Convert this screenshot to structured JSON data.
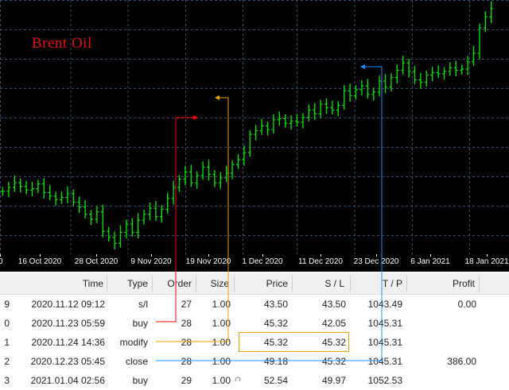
{
  "chart": {
    "symbol": "Brent Oil",
    "background": "#000000",
    "grid_color": "#2f4f6f",
    "candle_color": "#00dd00",
    "x_ticks": [
      "0",
      "16 Oct 2020",
      "28 Oct 2020",
      "9 Nov 2020",
      "19 Nov 2020",
      "1 Dec 2020",
      "11 Dec 2020",
      "23 Dec 2020",
      "6 Jan 2021",
      "18 Jan 2021"
    ]
  },
  "chart_data": {
    "type": "candlestick",
    "title": "Brent Oil",
    "x_start": "2020-10-05",
    "y_range": [
      35,
      56
    ],
    "candles": [
      [
        0,
        40.2
      ],
      [
        1,
        40.5
      ],
      [
        2,
        40.9
      ],
      [
        3,
        40.6
      ],
      [
        4,
        40.3
      ],
      [
        5,
        40.4
      ],
      [
        6,
        40.8
      ],
      [
        7,
        40.1
      ],
      [
        8,
        39.8
      ],
      [
        9,
        39.5
      ],
      [
        10,
        39.7
      ],
      [
        11,
        40.0
      ],
      [
        12,
        39.3
      ],
      [
        13,
        38.9
      ],
      [
        14,
        38.3
      ],
      [
        15,
        37.9
      ],
      [
        16,
        38.5
      ],
      [
        17,
        36.9
      ],
      [
        18,
        36.4
      ],
      [
        19,
        35.9
      ],
      [
        20,
        36.8
      ],
      [
        21,
        37.5
      ],
      [
        22,
        36.8
      ],
      [
        23,
        37.8
      ],
      [
        24,
        38.3
      ],
      [
        25,
        38.8
      ],
      [
        26,
        38.1
      ],
      [
        27,
        38.7
      ],
      [
        28,
        39.6
      ],
      [
        29,
        40.5
      ],
      [
        30,
        41.2
      ],
      [
        31,
        41.8
      ],
      [
        32,
        40.9
      ],
      [
        33,
        41.5
      ],
      [
        34,
        42.2
      ],
      [
        35,
        41.6
      ],
      [
        36,
        40.9
      ],
      [
        37,
        41.3
      ],
      [
        38,
        41.7
      ],
      [
        39,
        42.4
      ],
      [
        40,
        42.8
      ],
      [
        41,
        43.4
      ],
      [
        42,
        44.9
      ],
      [
        43,
        45.2
      ],
      [
        44,
        45.6
      ],
      [
        45,
        45.3
      ],
      [
        46,
        46.1
      ],
      [
        47,
        46.2
      ],
      [
        48,
        45.8
      ],
      [
        49,
        46.0
      ],
      [
        50,
        45.9
      ],
      [
        51,
        46.3
      ],
      [
        52,
        46.9
      ],
      [
        53,
        46.6
      ],
      [
        54,
        47.4
      ],
      [
        55,
        47.1
      ],
      [
        56,
        46.9
      ],
      [
        57,
        47.3
      ],
      [
        58,
        48.5
      ],
      [
        59,
        48.1
      ],
      [
        60,
        48.6
      ],
      [
        61,
        48.9
      ],
      [
        62,
        48.2
      ],
      [
        63,
        48.4
      ],
      [
        64,
        49.3
      ],
      [
        65,
        48.8
      ],
      [
        66,
        49.6
      ],
      [
        67,
        50.2
      ],
      [
        68,
        50.8
      ],
      [
        69,
        50.1
      ],
      [
        70,
        49.4
      ],
      [
        71,
        49.2
      ],
      [
        72,
        49.8
      ],
      [
        73,
        50.0
      ],
      [
        74,
        49.9
      ],
      [
        75,
        50.1
      ],
      [
        76,
        50.4
      ],
      [
        77,
        50.2
      ],
      [
        78,
        50.3
      ],
      [
        79,
        50.9
      ],
      [
        80,
        51.6
      ],
      [
        81,
        53.7
      ],
      [
        82,
        54.6
      ],
      [
        83,
        55.3
      ]
    ]
  },
  "table": {
    "headers": [
      "Time",
      "Type",
      "Order",
      "Size",
      "Price",
      "S / L",
      "T / P",
      "Profit"
    ],
    "rows": [
      {
        "num": "9",
        "time": "2020.11.12 09:12",
        "type": "s/l",
        "order": "27",
        "size": "1.00",
        "price": "43.50",
        "sl": "43.50",
        "tp": "1043.49",
        "profit": "0.00"
      },
      {
        "num": "0",
        "time": "2020.11.23 05:59",
        "type": "buy",
        "order": "28",
        "size": "1.00",
        "price": "45.32",
        "sl": "42.05",
        "tp": "1045.31",
        "profit": ""
      },
      {
        "num": "1",
        "time": "2020.11.24 14:36",
        "type": "modify",
        "order": "28",
        "size": "1.00",
        "price": "45.32",
        "sl": "45.32",
        "tp": "1045.31",
        "profit": ""
      },
      {
        "num": "2",
        "time": "2020.12.23 05:45",
        "type": "close",
        "order": "28",
        "size": "1.00",
        "price": "49.18",
        "sl": "45.32",
        "tp": "1045.31",
        "profit": "386.00"
      },
      {
        "num": "3",
        "time": "2021.01.04 02:56",
        "type": "buy",
        "order": "29",
        "size": "1.00",
        "price": "52.54",
        "sl": "49.97",
        "tp": "1052.53",
        "profit": ""
      }
    ]
  },
  "annotations": {
    "buy_color": "#ff0000",
    "modify_color": "#f0a000",
    "close_color": "#1e90ff"
  }
}
